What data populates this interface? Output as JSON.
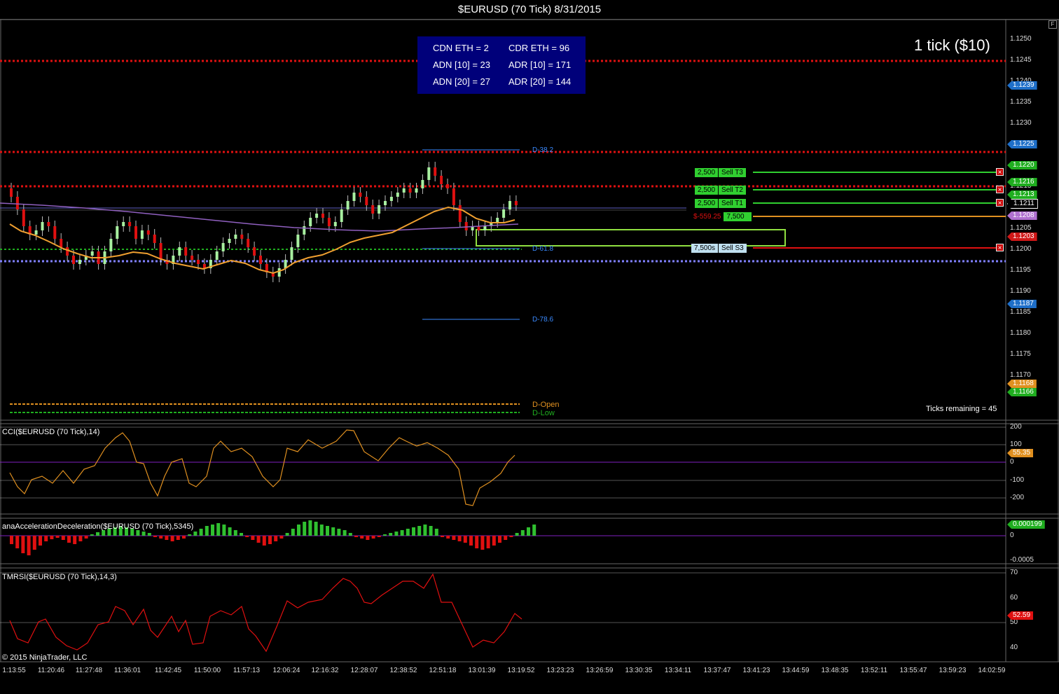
{
  "window": {
    "title": "$EURUSD (70 Tick)  8/31/2015",
    "float_btn": "F"
  },
  "stats": [
    {
      "label": "CDN ETH = 2",
      "label2": "CDR ETH = 96"
    },
    {
      "label": "ADN [10] = 23",
      "label2": "ADR [10] = 171"
    },
    {
      "label": "ADN [20] = 27",
      "label2": "ADR [20] = 144"
    }
  ],
  "tick_info": "1 tick ($10)",
  "ticks_remaining": "Ticks remaining = 45",
  "copyright": "© 2015 NinjaTrader, LLC",
  "panels": {
    "cci": "CCI($EURUSD (70 Tick),14)",
    "ana": "anaAccelerationDeceleration($EURUSD (70 Tick),5345)",
    "tmrsi": "TMRSI($EURUSD (70 Tick),14,3)"
  },
  "price_axis": [
    "1.1250",
    "1.1245",
    "1.1240",
    "1.1235",
    "1.1230",
    "1.1225",
    "1.1220",
    "1.1215",
    "1.1210",
    "1.1205",
    "1.1200",
    "1.1195",
    "1.1190",
    "1.1185",
    "1.1180",
    "1.1175",
    "1.1170"
  ],
  "price_tags": [
    {
      "value": "1.1239",
      "color": "#1e6fc9"
    },
    {
      "value": "1.1225",
      "color": "#1e6fc9"
    },
    {
      "value": "1.1220",
      "color": "#1fae1f"
    },
    {
      "value": "1.1216",
      "color": "#1fae1f"
    },
    {
      "value": "1.1213",
      "color": "#1fae1f"
    },
    {
      "value": "1.1211",
      "color": "#000000"
    },
    {
      "value": "1.1208",
      "color": "#b070d0"
    },
    {
      "value": "1.1203",
      "color": "#d01818"
    },
    {
      "value": "1.1187",
      "color": "#1e6fc9"
    },
    {
      "value": "1.1168",
      "color": "#e09020"
    },
    {
      "value": "1.1166",
      "color": "#1fae1f"
    }
  ],
  "fib_labels": {
    "d382": "D-38.2",
    "d618": "D-61.8",
    "d786": "D-78.6",
    "dopen": "D-Open",
    "dlow": "D-Low"
  },
  "orders": [
    {
      "qty": "2,500",
      "name": "Sell T3",
      "price": "1.1220"
    },
    {
      "qty": "2,500",
      "name": "Sell T2",
      "price": "1.1216"
    },
    {
      "qty": "2,500",
      "name": "Sell T1",
      "price": "1.1213"
    },
    {
      "qty": "7,500s",
      "name": "Sell S3",
      "price": "1.1203"
    }
  ],
  "position": {
    "pnl": "$-559.25",
    "qty": "7,500"
  },
  "cci_axis": [
    "200",
    "100",
    "0",
    "-100",
    "-200"
  ],
  "cci_value": "55.35",
  "ana_axis": [
    "0",
    "-0.0005"
  ],
  "ana_value": "0.000199",
  "tmrsi_axis": [
    "70",
    "60",
    "50",
    "40"
  ],
  "tmrsi_value": "52.59",
  "time_axis": [
    "1:13:55",
    "11:20:46",
    "11:27:48",
    "11:36:01",
    "11:42:45",
    "11:50:00",
    "11:57:13",
    "12:06:24",
    "12:16:32",
    "12:28:07",
    "12:38:52",
    "12:51:18",
    "13:01:39",
    "13:19:52",
    "13:23:23",
    "13:26:59",
    "13:30:35",
    "13:34:11",
    "13:37:47",
    "13:41:23",
    "13:44:59",
    "13:48:35",
    "13:52:11",
    "13:55:47",
    "13:59:23",
    "14:02:59"
  ],
  "colors": {
    "bull": "#a8f0a0",
    "bear": "#e01010",
    "ema": "#f0a030",
    "sma": "#9060c0",
    "fib": "#3a8aff",
    "hline_red": "#e01010",
    "hline_purple": "#8080ff"
  }
}
